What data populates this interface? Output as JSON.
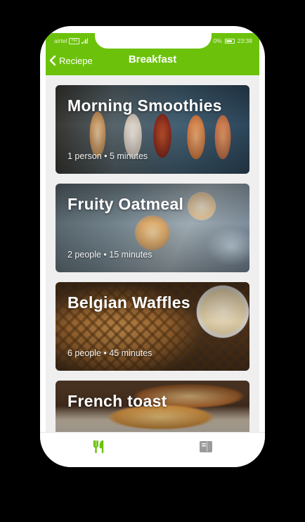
{
  "status_bar": {
    "carrier": "airtel",
    "network_badge": "HD",
    "battery_percent": "0%",
    "time": "23:38"
  },
  "app_bar": {
    "back_label": "Reciepe",
    "title": "Breakfast"
  },
  "recipes": [
    {
      "title": "Morning Smoothies",
      "meta": "1 person • 5 minutes"
    },
    {
      "title": "Fruity Oatmeal",
      "meta": "2 people • 15 minutes"
    },
    {
      "title": "Belgian Waffles",
      "meta": "6 people • 45 minutes"
    },
    {
      "title": "French toast",
      "meta": ""
    }
  ],
  "bottom_nav": {
    "items": [
      {
        "icon": "fork-knife-icon",
        "active": true
      },
      {
        "icon": "book-icon",
        "active": false
      }
    ]
  },
  "colors": {
    "accent": "#6cc20b",
    "inactive_icon": "#9a9a9a"
  }
}
